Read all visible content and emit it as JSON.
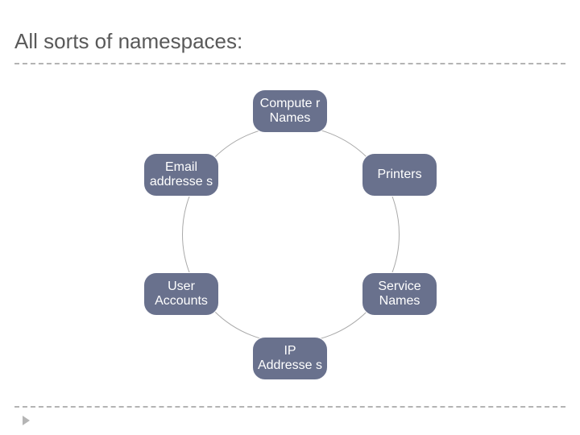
{
  "title": "All sorts of namespaces:",
  "nodes": {
    "top": "Compute\nr Names",
    "ur": "Printers",
    "lr": "Service Names",
    "bottom": "IP Addresse\ns",
    "ll": "User Accounts",
    "ul": "Email addresse\ns"
  }
}
